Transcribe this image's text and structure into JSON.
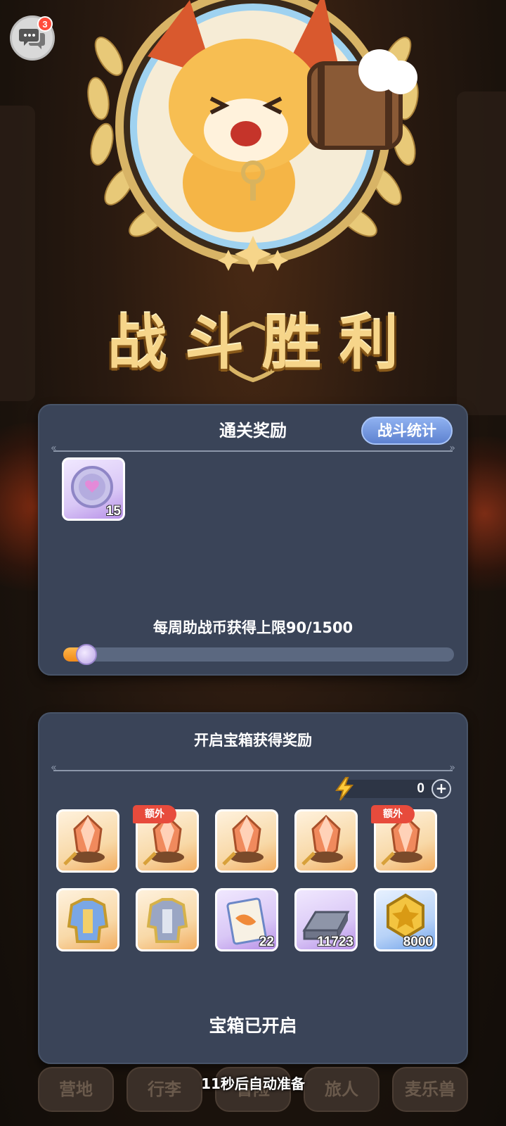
{
  "chat": {
    "badge_count": "3",
    "icon": "chat-bubbles-icon"
  },
  "victory": {
    "title": "战斗胜利",
    "emblem": "cat-warrior-with-hammer-emblem"
  },
  "clear_rewards": {
    "title": "通关奖励",
    "stats_button": "战斗统计",
    "items": [
      {
        "icon": "support-coin-icon",
        "rarity": "purple",
        "count": "15"
      }
    ],
    "weekly_limit_text": "每周助战币获得上限90/1500",
    "weekly_progress": 0.06
  },
  "chest_rewards": {
    "title": "开启宝箱获得奖励",
    "energy": {
      "value": "0",
      "icon": "lightning-bolt-icon",
      "plus_icon": "plus-icon"
    },
    "extra_tag": "额外",
    "items": [
      {
        "icon": "crystal-ore-sword-icon",
        "rarity": "orange",
        "count": "",
        "extra": false
      },
      {
        "icon": "crystal-ore-boots-icon",
        "rarity": "orange",
        "count": "",
        "extra": true
      },
      {
        "icon": "crystal-ore-gauntlet-icon",
        "rarity": "orange",
        "count": "",
        "extra": false
      },
      {
        "icon": "crystal-ore-boots-icon",
        "rarity": "orange",
        "count": "",
        "extra": false
      },
      {
        "icon": "crystal-ore-sword-icon",
        "rarity": "orange",
        "count": "",
        "extra": true
      },
      {
        "icon": "gold-armor-icon",
        "rarity": "orange",
        "count": "",
        "extra": false
      },
      {
        "icon": "silver-armor-icon",
        "rarity": "orange",
        "count": "",
        "extra": false
      },
      {
        "icon": "ticket-scroll-icon",
        "rarity": "purple",
        "count": "22",
        "extra": false
      },
      {
        "icon": "iron-ingot-icon",
        "rarity": "purple",
        "count": "11723",
        "extra": false
      },
      {
        "icon": "gold-coin-icon",
        "rarity": "blue",
        "count": "8000",
        "extra": false
      }
    ],
    "status": "宝箱已开启"
  },
  "bottom_nav": {
    "items": [
      "营地",
      "行李",
      "冒险",
      "旅人",
      "麦乐兽"
    ],
    "auto_ready_text": "11秒后自动准备"
  },
  "colors": {
    "panel": "#3a4458",
    "gold": "#f6d58a",
    "extra_tag": "#e74b3c",
    "stats_button": "#6f91dd"
  }
}
